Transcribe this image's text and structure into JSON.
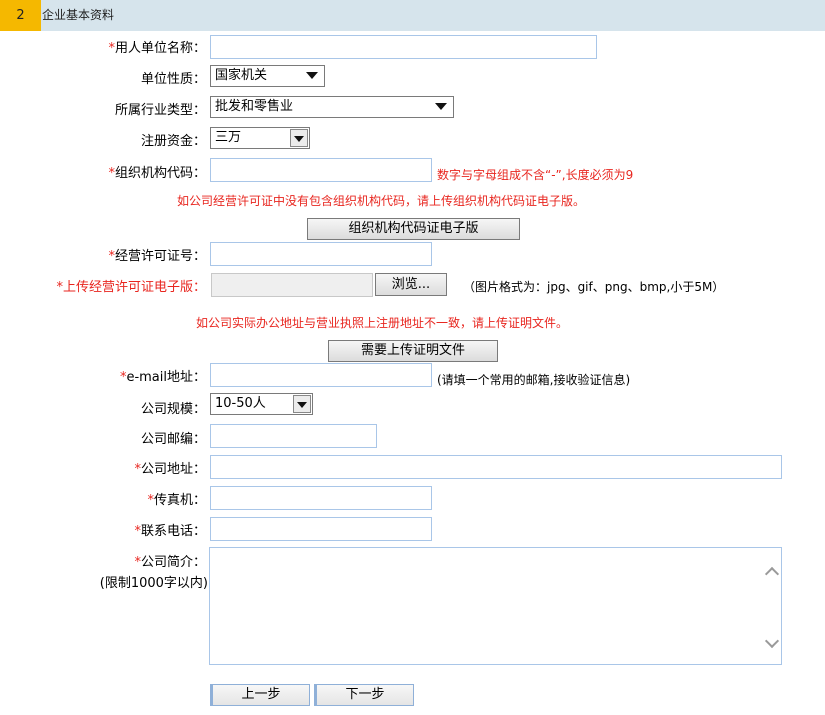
{
  "section": {
    "number": "2",
    "title": "企业基本资料"
  },
  "fields": {
    "employer_name": {
      "required": "*",
      "label": "用人单位名称：",
      "value": ""
    },
    "unit_nature": {
      "label": "单位性质：",
      "selected": "国家机关"
    },
    "industry": {
      "label": "所属行业类型：",
      "selected": "批发和零售业"
    },
    "capital": {
      "label": "注册资金：",
      "selected": "三万"
    },
    "org_code": {
      "required": "*",
      "label": "组织机构代码：",
      "value": "",
      "hint": "数字与字母组成不含“-”,长度必须为9"
    },
    "org_notice": "如公司经营许可证中没有包含组织机构代码，请上传组织机构代码证电子版。",
    "org_upload_button": "组织机构代码证电子版",
    "license_no": {
      "required": "*",
      "label": "经营许可证号：",
      "value": ""
    },
    "license_upload": {
      "required": "*",
      "label": "上传经营许可证电子版：",
      "browse": "浏览...",
      "hint": "（图片格式为：jpg、gif、png、bmp,小于5M）"
    },
    "address_notice": "如公司实际办公地址与营业执照上注册地址不一致，请上传证明文件。",
    "proof_upload_button": "需要上传证明文件",
    "email": {
      "required": "*",
      "label": "e-mail地址：",
      "value": "",
      "hint": "(请填一个常用的邮箱,接收验证信息)"
    },
    "company_size": {
      "label": "公司规模：",
      "selected": "10-50人"
    },
    "postcode": {
      "label": "公司邮编：",
      "value": ""
    },
    "company_address": {
      "required": "*",
      "label": "公司地址：",
      "value": ""
    },
    "fax": {
      "required": "*",
      "label": "传真机：",
      "value": ""
    },
    "phone": {
      "required": "*",
      "label": "联系电话：",
      "value": ""
    },
    "intro": {
      "required": "*",
      "label": "公司简介：",
      "sub_label": "(限制1000字以内)",
      "value": ""
    }
  },
  "buttons": {
    "prev": "上一步",
    "next": "下一步"
  },
  "colors": {
    "header_bg": "#d6e4ec",
    "step_badge": "#f5b800",
    "required_red": "#e8261f",
    "input_border": "#a9c6e8"
  }
}
